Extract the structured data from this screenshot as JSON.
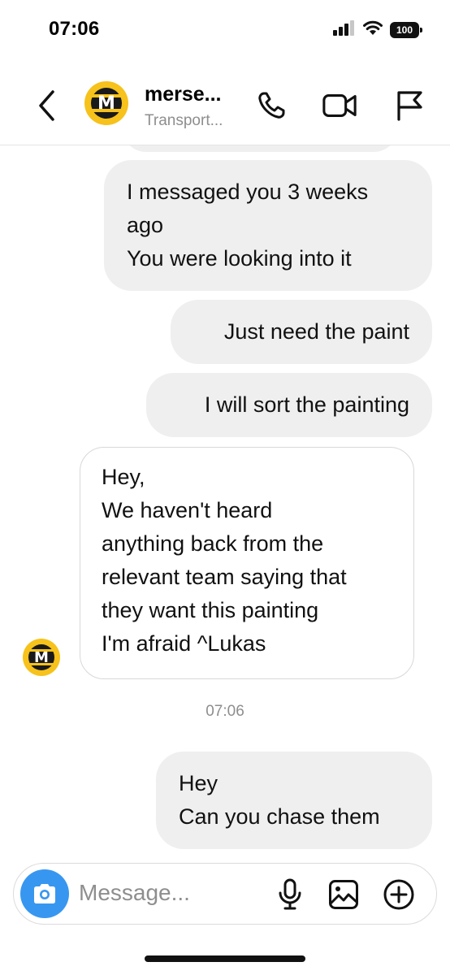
{
  "status_bar": {
    "time": "07:06",
    "battery": "100",
    "icons": [
      "signal-icon",
      "wifi-icon",
      "battery-icon"
    ]
  },
  "header": {
    "contact_name": "merse...",
    "contact_subtitle": "Transport...",
    "avatar_letter": "M",
    "icons": [
      "back-chevron-icon",
      "phone-icon",
      "video-icon",
      "flag-icon"
    ]
  },
  "messages": [
    {
      "direction": "outgoing",
      "text": "I messaged you 3 weeks\nago\nYou were looking into it"
    },
    {
      "direction": "outgoing",
      "text": "Just need the paint"
    },
    {
      "direction": "outgoing",
      "text": "I will sort the painting"
    },
    {
      "direction": "incoming",
      "text": "Hey,\nWe haven't heard\nanything back from the\nrelevant team saying that\nthey want this painting\nI'm afraid ^Lukas"
    },
    {
      "direction": "outgoing",
      "text": "Hey\nCan you chase them"
    }
  ],
  "timestamp": "07:06",
  "composer": {
    "placeholder": "Message...",
    "icons": [
      "camera-icon",
      "microphone-icon",
      "gallery-icon",
      "plus-icon"
    ]
  },
  "colors": {
    "accent": "#3797f0",
    "outgoing_bubble": "#efefef",
    "brand_yellow": "#f6c21b",
    "secondary_text": "#8e8e8e"
  }
}
